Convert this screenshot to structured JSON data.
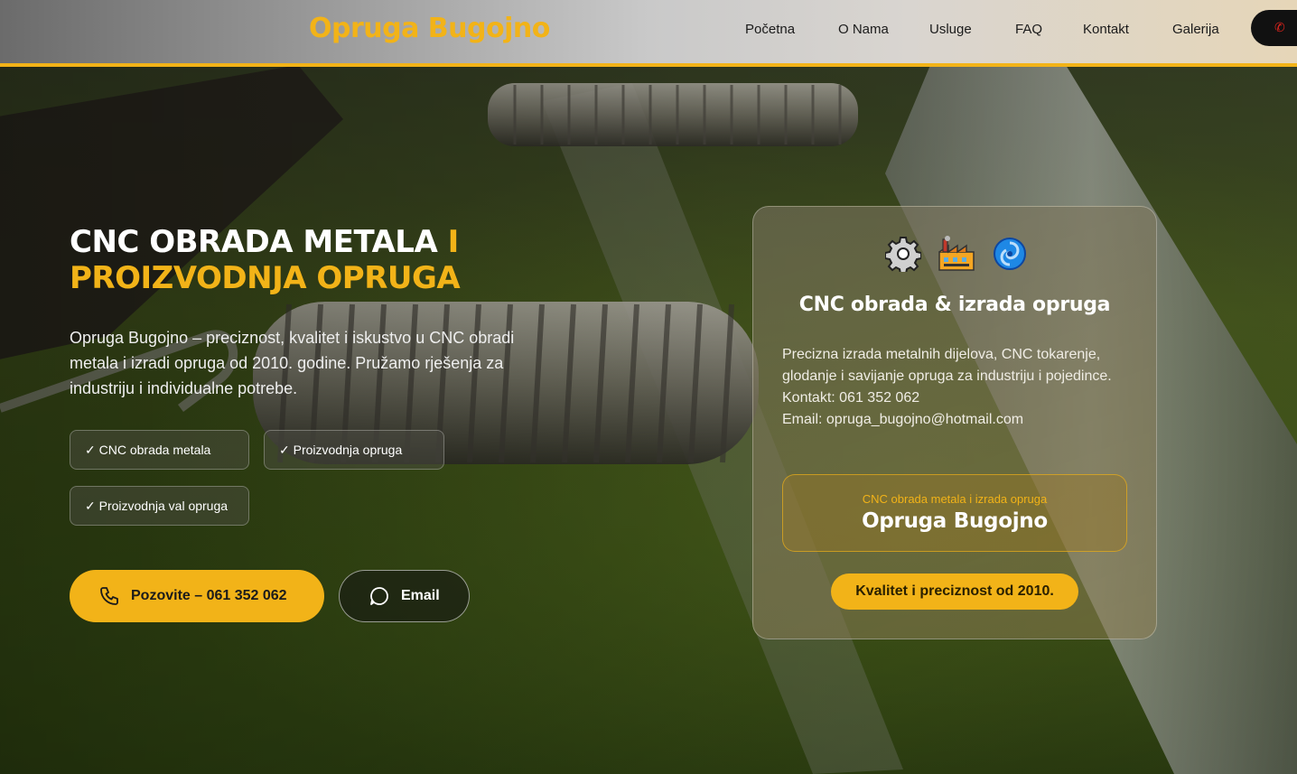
{
  "header": {
    "logo": "Opruga Bugojno",
    "nav": [
      "Početna",
      "O Nama",
      "Usluge",
      "FAQ",
      "Kontakt",
      "Galerija"
    ]
  },
  "hero": {
    "title_white": "CNC OBRADA METALA ",
    "title_gold_1": "I",
    "title_gold_2": "PROIZVODNJA OPRUGA",
    "lead": "Opruga Bugojno – preciznost, kvalitet i iskustvo u CNC obradi metala i izradi opruga od 2010. godine. Pružamo rješenja za industriju i individualne potrebe.",
    "chips": [
      "✓ CNC obrada metala",
      "✓ Proizvodnja opruga",
      "✓ Proizvodnja val opruga"
    ],
    "call_label": "Pozovite – 061 352 062",
    "email_label": "Email"
  },
  "card": {
    "icons": [
      "gear-icon",
      "factory-icon",
      "cyclone-icon"
    ],
    "title": "CNC obrada & izrada opruga",
    "description": "Precizna izrada metalnih dijelova, CNC tokarenje, glodanje i savijanje opruga za industriju i pojedince.",
    "contact": "Kontakt: 061 352 062",
    "email": "Email: opruga_bugojno@hotmail.com",
    "inner_subtitle": "CNC obrada metala i izrada opruga",
    "inner_name": "Opruga Bugojno",
    "badge": "Kvalitet i preciznost od 2010."
  },
  "colors": {
    "accent": "#f2b318",
    "phone_red": "#e0241d"
  }
}
